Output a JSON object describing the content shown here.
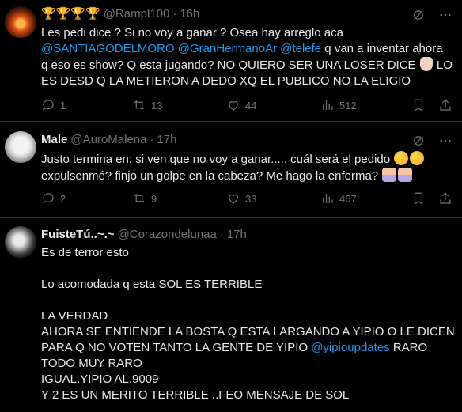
{
  "tweets": [
    {
      "badge": "🏆🏆🏆🏆",
      "name": "",
      "handle": "@Rampl100",
      "time": "16h",
      "lines": [
        [
          {
            "t": "Les pedi dice ? Si no voy a ganar ? Osea hay arreglo aca"
          }
        ],
        [
          {
            "t": "@SANTIAGODELMORO",
            "link": true
          },
          {
            "t": " "
          },
          {
            "t": "@GranHermanoAr",
            "link": true
          },
          {
            "t": " "
          },
          {
            "t": "@telefe",
            "link": true
          },
          {
            "t": "  q van a inventar ahora"
          }
        ],
        [
          {
            "t": "q eso es show? Q esta jugando? NO QUIERO SER UNA LOSER DICE "
          },
          {
            "emoji": "hand"
          },
          {
            "t": " LO"
          }
        ],
        [
          {
            "t": "ES DESD Q LA METIERON A DEDO XQ EL PUBLICO NO LA ELIGIO"
          }
        ]
      ],
      "stats": {
        "replies": "1",
        "retweets": "13",
        "likes": "44",
        "views": "512"
      }
    },
    {
      "badge": "",
      "name": "Male",
      "handle": "@AuroMalena",
      "time": "17h",
      "lines": [
        [
          {
            "t": "Justo termina en: si ven que no voy a ganar..... cuál será el pedido "
          },
          {
            "emoji": "think"
          },
          {
            "emoji": "think"
          }
        ],
        [
          {
            "t": "expulsenmé? finjo un golpe en la cabeza? Me hago la enferma? "
          },
          {
            "emoji": "person"
          },
          {
            "emoji": "person"
          }
        ]
      ],
      "stats": {
        "replies": "2",
        "retweets": "9",
        "likes": "33",
        "views": "467"
      }
    },
    {
      "badge": "",
      "name": "FuisteTú..~.~",
      "handle": "@Corazondelunaa",
      "time": "17h",
      "lines": [
        [
          {
            "t": "Es de terror esto"
          }
        ],
        [
          {
            "t": ""
          }
        ],
        [
          {
            "t": "Lo acomodada q esta SOL ES TERRIBLE"
          }
        ],
        [
          {
            "t": ""
          }
        ],
        [
          {
            "t": "LA VERDAD"
          }
        ],
        [
          {
            "t": "AHORA SE ENTIENDE LA BOSTA Q ESTA LARGANDO A YIPIO O LE DICEN"
          }
        ],
        [
          {
            "t": "PARA Q NO VOTEN TANTO LA GENTE DE YIPIO "
          },
          {
            "t": "@yipioupdates",
            "link": true
          },
          {
            "t": " RARO"
          }
        ],
        [
          {
            "t": "TODO MUY RARO"
          }
        ],
        [
          {
            "t": "IGUAL.YIPIO AL.9009"
          }
        ],
        [
          {
            "t": "Y 2 ES UN MERITO TERRIBLE ..FEO MENSAJE DE SOL"
          }
        ]
      ]
    }
  ],
  "colors": {
    "background": "#000000",
    "text": "#e7e9ea",
    "muted": "#71767b",
    "link": "#1d9bf0",
    "divider": "#2f3336"
  },
  "icons": [
    "reply-icon",
    "retweet-icon",
    "like-icon",
    "views-icon",
    "bookmark-icon",
    "share-icon",
    "grok-icon",
    "more-icon"
  ]
}
